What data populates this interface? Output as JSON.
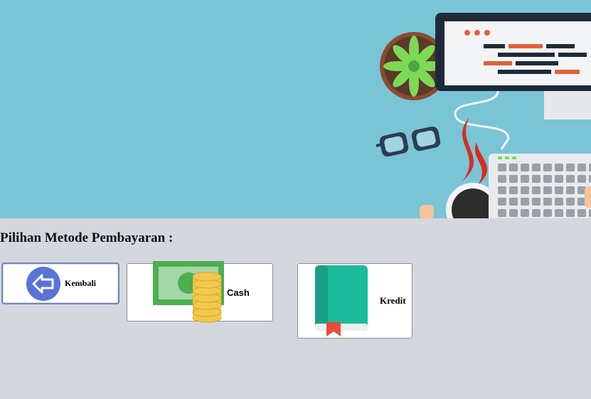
{
  "page": {
    "heading": "Pilihan Metode Pembayaran :"
  },
  "buttons": {
    "back": {
      "label": "Kembali",
      "icon": "back-arrow-icon"
    },
    "cash": {
      "label": "Cash",
      "icon": "money-coins-icon"
    },
    "kredit": {
      "label": "Kredit",
      "icon": "book-icon"
    }
  },
  "colors": {
    "banner": "#79c5d6",
    "page_bg": "#d5d7df",
    "back_icon": "#5a73d8",
    "book": "#1abc9c",
    "bookmark": "#e74c3c",
    "coin": "#f2c94c",
    "bill": "#4caf50"
  }
}
